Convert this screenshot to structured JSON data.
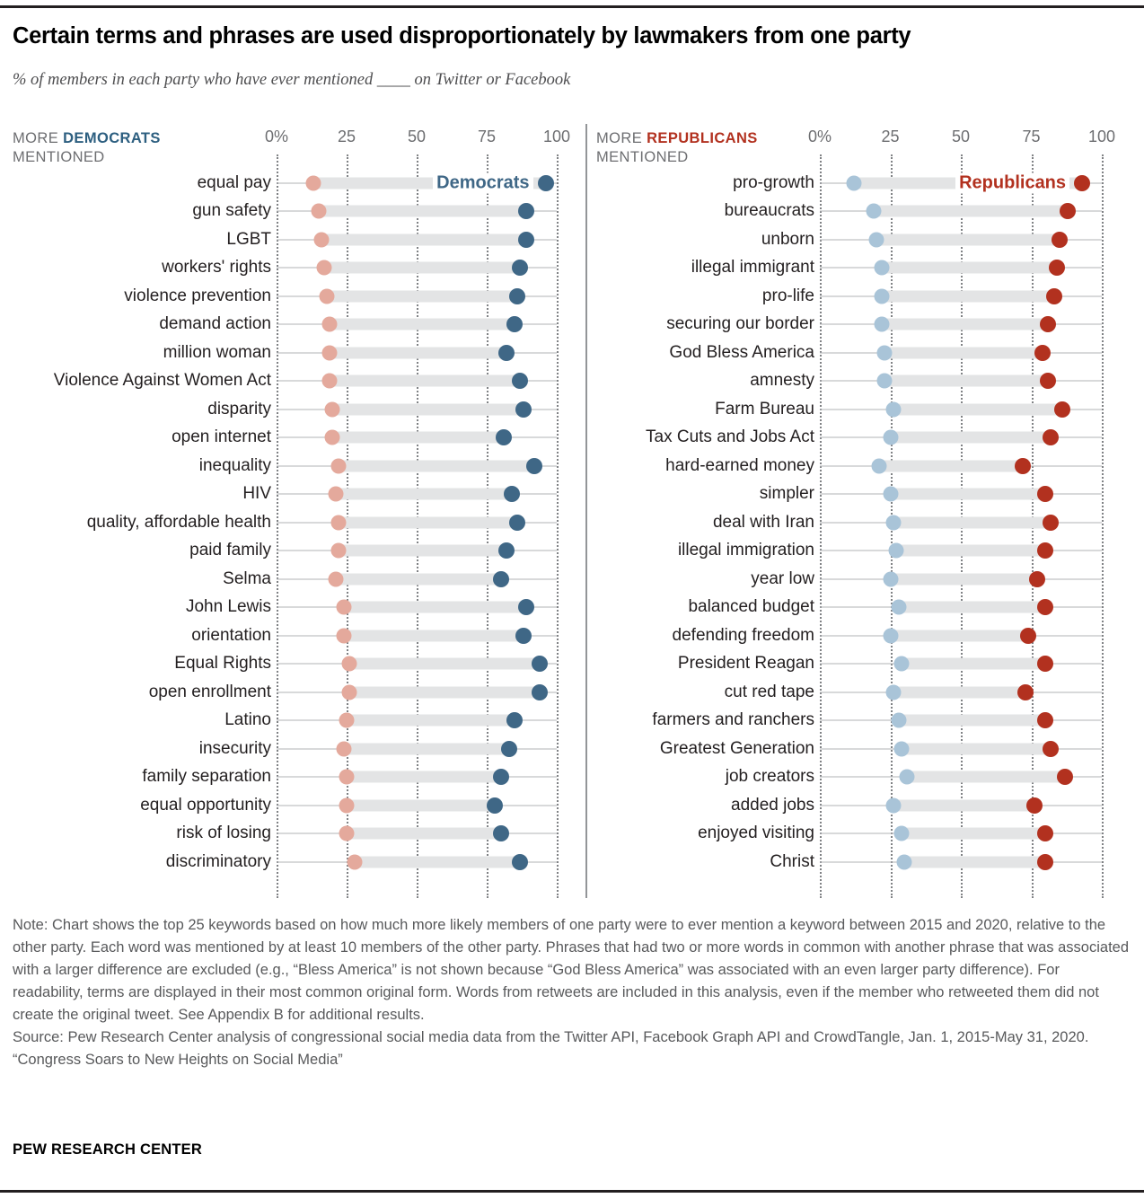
{
  "title": "Certain terms and phrases are used disproportionately by lawmakers from one party",
  "subtitle": "% of members in each party who have ever mentioned ____ on Twitter or Facebook",
  "colors": {
    "democrat_dot": "#3f6786",
    "democrat_light_dot": "#a9c4d8",
    "republican_dot": "#b2311f",
    "republican_light_dot": "#e4a99c",
    "connector": "#e3e4e5",
    "baseline": "#b1b3b6",
    "gridline": "#808285",
    "dem_text": "#2d5f80",
    "rep_text": "#b2311f"
  },
  "panels": [
    {
      "id": "democrats",
      "header_prefix": "MORE ",
      "header_party": "DEMOCRATS",
      "header_suffix": "MENTIONED",
      "legend_label": "Democrats",
      "axis": {
        "ticks": [
          "0%",
          "25",
          "50",
          "75",
          "100"
        ],
        "values": [
          0,
          25,
          50,
          75,
          100
        ],
        "min": 0,
        "max": 100
      }
    },
    {
      "id": "republicans",
      "header_prefix": "MORE ",
      "header_party": "REPUBLICANS",
      "header_suffix": "MENTIONED",
      "legend_label": "Republicans",
      "axis": {
        "ticks": [
          "0%",
          "25",
          "50",
          "75",
          "100"
        ],
        "values": [
          0,
          25,
          50,
          75,
          100
        ],
        "min": 0,
        "max": 100
      }
    }
  ],
  "footer": {
    "note": "Note: Chart shows the top 25 keywords based on how much more likely members of one party were to ever mention a keyword between 2015 and 2020, relative to the other party. Each word was mentioned by at least 10 members of the other party. Phrases that had two or more words in common with another phrase that was associated with a larger difference are excluded (e.g., “Bless America” is not shown because “God Bless America” was associated with an even larger party difference). For readability, terms are displayed in their most common original form. Words from retweets are included in this analysis, even if the member who retweeted them did not create the original tweet. See Appendix B for additional results.",
    "source": "Source: Pew Research Center analysis of congressional social media data from the Twitter API, Facebook Graph API and CrowdTangle, Jan. 1, 2015-May 31, 2020.",
    "report": "“Congress Soars to New Heights on Social Media”",
    "brand": "PEW RESEARCH CENTER"
  },
  "chart_data": {
    "type": "dumbbell",
    "title": "Certain terms and phrases are used disproportionately by lawmakers from one party",
    "subtitle": "% of members in each party who have ever mentioned ____ on Twitter or Facebook",
    "xlabel": "",
    "ylabel": "",
    "xlim": [
      0,
      100
    ],
    "xticks": [
      0,
      25,
      50,
      75,
      100
    ],
    "xticklabels": [
      "0%",
      "25",
      "50",
      "75",
      "100"
    ],
    "grid": "vertical-dotted",
    "legend_position": "inline-first-row",
    "panels": [
      {
        "name": "More Democrats mentioned",
        "series": [
          {
            "name": "Republicans",
            "color": "#e4a99c"
          },
          {
            "name": "Democrats",
            "color": "#3f6786"
          }
        ],
        "categories": [
          "equal pay",
          "gun safety",
          "LGBT",
          "workers' rights",
          "violence prevention",
          "demand action",
          "million woman",
          "Violence Against Women Act",
          "disparity",
          "open internet",
          "inequality",
          "HIV",
          "quality, affordable health",
          "paid family",
          "Selma",
          "John Lewis",
          "orientation",
          "Equal Rights",
          "open enrollment",
          "Latino",
          "insecurity",
          "family separation",
          "equal opportunity",
          "risk of losing",
          "discriminatory"
        ],
        "republican_values": [
          13,
          15,
          16,
          17,
          18,
          19,
          19,
          19,
          20,
          20,
          22,
          21,
          22,
          22,
          21,
          24,
          24,
          26,
          26,
          25,
          24,
          25,
          25,
          25,
          28
        ],
        "democrat_values": [
          96,
          89,
          89,
          87,
          86,
          85,
          82,
          87,
          88,
          81,
          92,
          84,
          86,
          82,
          80,
          89,
          88,
          94,
          94,
          85,
          83,
          80,
          78,
          80,
          87
        ]
      },
      {
        "name": "More Republicans mentioned",
        "series": [
          {
            "name": "Democrats",
            "color": "#a9c4d8"
          },
          {
            "name": "Republicans",
            "color": "#b2311f"
          }
        ],
        "categories": [
          "pro-growth",
          "bureaucrats",
          "unborn",
          "illegal immigrant",
          "pro-life",
          "securing our border",
          "God Bless America",
          "amnesty",
          "Farm Bureau",
          "Tax Cuts and Jobs Act",
          "hard-earned money",
          "simpler",
          "deal with Iran",
          "illegal immigration",
          "year low",
          "balanced budget",
          "defending freedom",
          "President Reagan",
          "cut red tape",
          "farmers and ranchers",
          "Greatest Generation",
          "job creators",
          "added jobs",
          "enjoyed visiting",
          "Christ"
        ],
        "democrat_values": [
          12,
          19,
          20,
          22,
          22,
          22,
          23,
          23,
          26,
          25,
          21,
          25,
          26,
          27,
          25,
          28,
          25,
          29,
          26,
          28,
          29,
          31,
          26,
          29,
          30
        ],
        "republican_values": [
          93,
          88,
          85,
          84,
          83,
          81,
          79,
          81,
          86,
          82,
          72,
          80,
          82,
          80,
          77,
          80,
          74,
          80,
          73,
          80,
          82,
          87,
          76,
          80,
          80
        ]
      }
    ]
  }
}
